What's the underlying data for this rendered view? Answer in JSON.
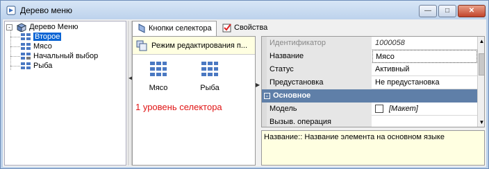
{
  "window": {
    "title": "Дерево меню",
    "minimize_icon": "minimize-icon",
    "maximize_icon": "maximize-icon",
    "close_icon": "close-icon"
  },
  "tree": {
    "root": {
      "label": "Дерево Меню",
      "icon": "menu-tree-icon"
    },
    "items": [
      {
        "label": "Второе",
        "selected": true,
        "icon": "grid-icon"
      },
      {
        "label": "Мясо",
        "selected": false,
        "icon": "grid-icon"
      },
      {
        "label": "Начальный выбор",
        "selected": false,
        "icon": "grid-icon"
      },
      {
        "label": "Рыба",
        "selected": false,
        "icon": "grid-icon"
      }
    ]
  },
  "tabs": [
    {
      "label": "Кнопки селектора",
      "active": true,
      "icon": "selector-icon"
    },
    {
      "label": "Свойства",
      "active": false,
      "icon": "properties-icon"
    }
  ],
  "selector": {
    "mode_label": "Режим редактирования п...",
    "buttons": [
      {
        "label": "Мясо"
      },
      {
        "label": "Рыба"
      }
    ],
    "level_text": "1 уровень селектора"
  },
  "properties": {
    "rows": [
      {
        "name": "Идентификатор",
        "value": "1000058"
      },
      {
        "name": "Название",
        "value": "Мясо"
      },
      {
        "name": "Статус",
        "value": "Активный"
      },
      {
        "name": "Предустановка",
        "value": "Не предустановка"
      }
    ],
    "category": "Основное",
    "model": {
      "name": "Модель",
      "value": "[Макет]"
    },
    "call_op": {
      "name": "Вызыв. операция",
      "value": ""
    }
  },
  "description": "Название:: Название элемента на основном языке",
  "colors": {
    "selection": "#0a64d4",
    "category": "#5f7fa8",
    "info_bg": "#ffffe1",
    "level_text": "#e01414"
  }
}
